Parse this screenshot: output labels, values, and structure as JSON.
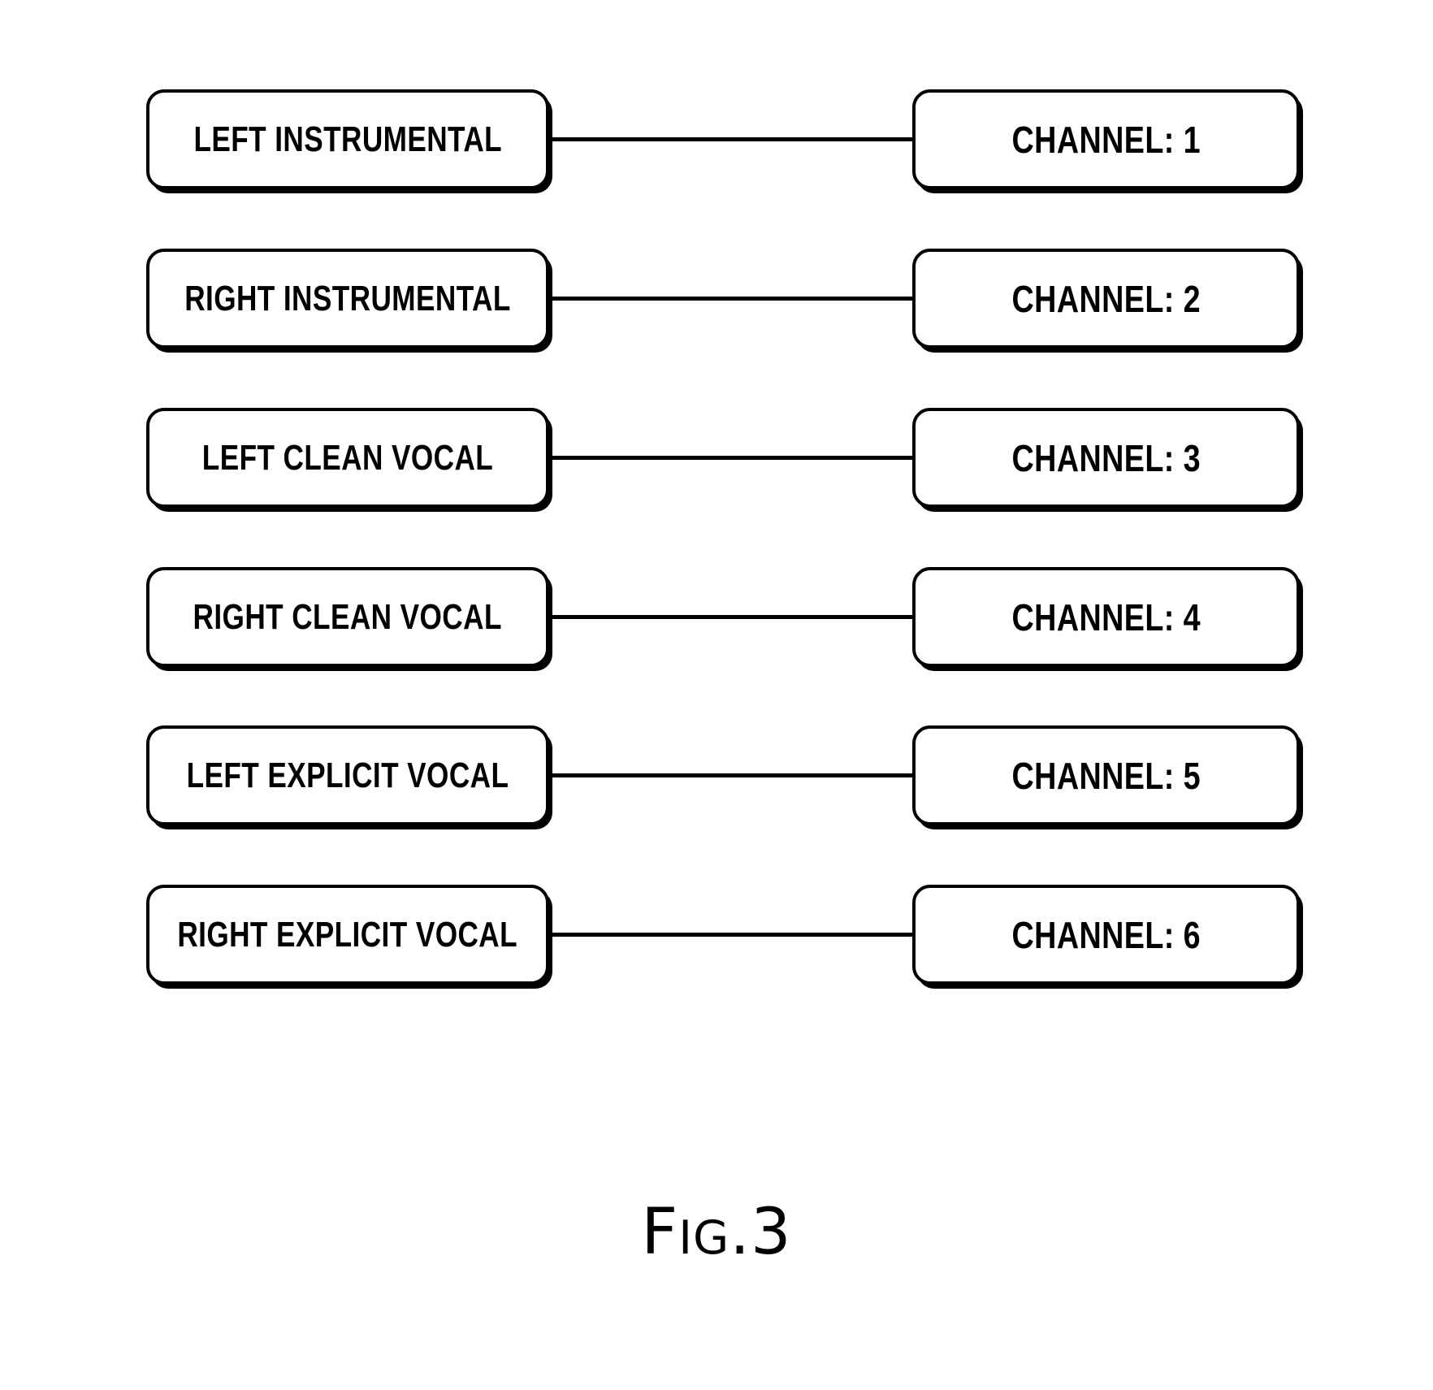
{
  "figure": {
    "caption_full": "FIG.3",
    "caption_cap": "F",
    "caption_small": "IG",
    "caption_num": ".3"
  },
  "rows": [
    {
      "source": "LEFT INSTRUMENTAL",
      "channel": "CHANNEL: 1"
    },
    {
      "source": "RIGHT INSTRUMENTAL",
      "channel": "CHANNEL: 2"
    },
    {
      "source": "LEFT CLEAN VOCAL",
      "channel": "CHANNEL: 3"
    },
    {
      "source": "RIGHT CLEAN VOCAL",
      "channel": "CHANNEL: 4"
    },
    {
      "source": "LEFT EXPLICIT VOCAL",
      "channel": "CHANNEL: 5"
    },
    {
      "source": "RIGHT EXPLICIT VOCAL",
      "channel": "CHANNEL: 6"
    }
  ],
  "colors": {
    "stroke": "#000000",
    "background": "#ffffff"
  }
}
